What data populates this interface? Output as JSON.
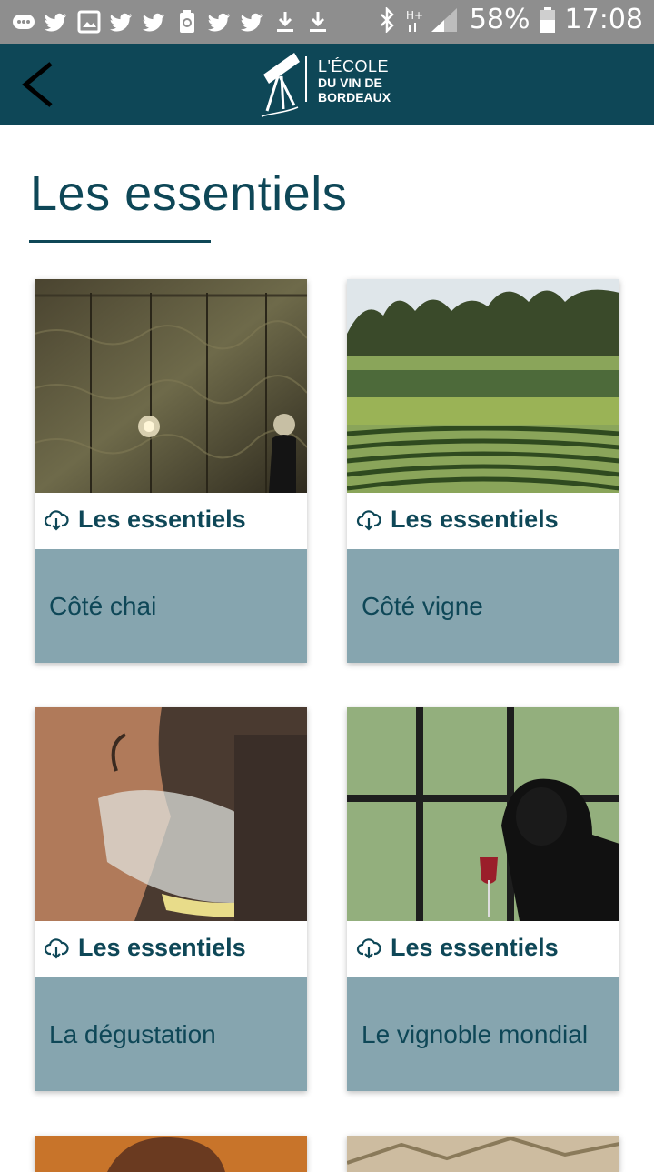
{
  "status_bar": {
    "battery": "58%",
    "time": "17:08",
    "icons": [
      "chat-icon",
      "twitter-icon",
      "image-icon",
      "twitter-icon",
      "twitter-icon",
      "recycle-icon",
      "twitter-icon",
      "twitter-icon",
      "download-icon",
      "download-icon",
      "bluetooth-icon",
      "signal-icon",
      "battery-icon"
    ]
  },
  "header": {
    "logo": {
      "line1": "L'ÉCOLE",
      "line2": "DU VIN DE",
      "line3": "BORDEAUX"
    }
  },
  "page_title": "Les essentiels",
  "cards": [
    {
      "label": "Les essentiels",
      "title": "Côté chai"
    },
    {
      "label": "Les essentiels",
      "title": "Côté vigne"
    },
    {
      "label": "Les essentiels",
      "title": "La dégustation"
    },
    {
      "label": "Les essentiels",
      "title": "Le vignoble mondial"
    }
  ],
  "colors": {
    "primary": "#0e4757",
    "card_bottom": "#86a5af",
    "status_bar": "#8e8e8e"
  }
}
